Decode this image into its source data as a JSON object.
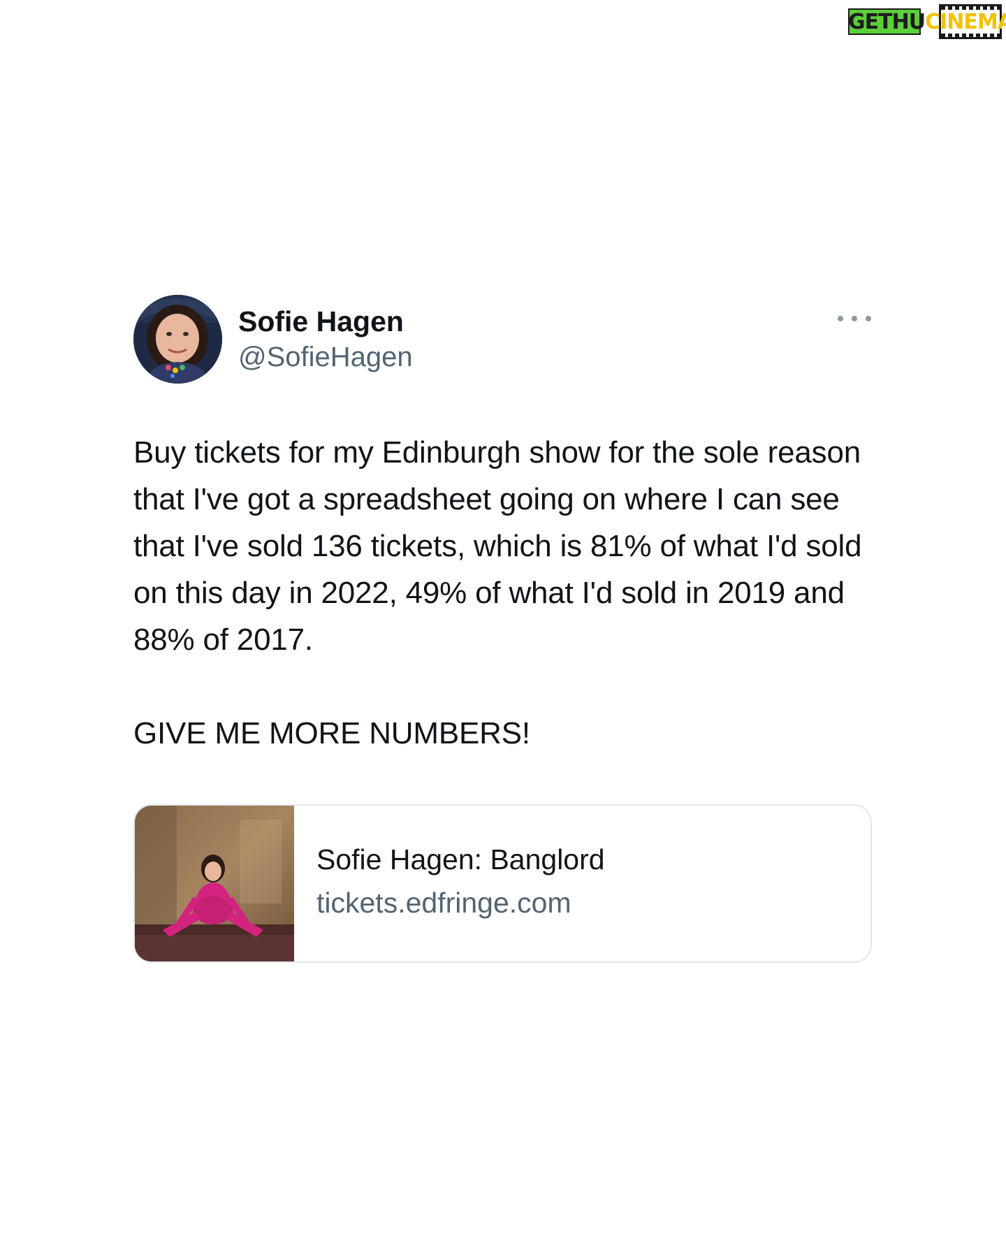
{
  "watermark": {
    "part_a": "GETHU",
    "part_b": "CINEMA"
  },
  "tweet": {
    "author": {
      "name": "Sofie Hagen",
      "handle": "@SofieHagen",
      "avatar_icon": "profile-photo"
    },
    "more_icon": "more-options-icon",
    "text": "Buy tickets for my Edinburgh show for the sole reason that I've got a spreadsheet going on where I can see that I've sold 136 tickets, which is 81% of what I'd sold on this day in 2022, 49% of what I'd sold in 2019 and 88% of 2017.\n\nGIVE ME MORE NUMBERS!",
    "link_card": {
      "title": "Sofie Hagen: Banglord",
      "domain": "tickets.edfringe.com",
      "thumbnail_icon": "show-poster-image"
    }
  },
  "colors": {
    "text_primary": "#0f1419",
    "text_secondary": "#536471",
    "card_border": "#e1e6ea",
    "background": "#ffffff"
  }
}
